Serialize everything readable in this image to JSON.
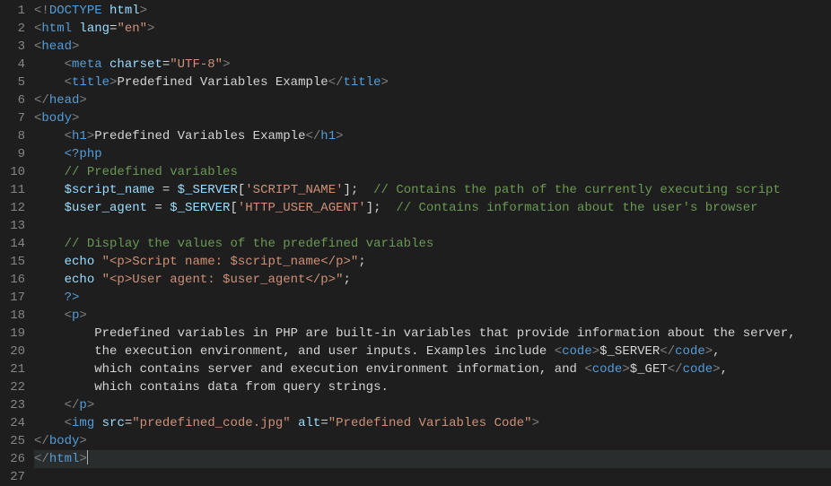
{
  "lineCount": 27,
  "activeLine": 26,
  "lines": [
    [
      [
        "tag-punct",
        "<!"
      ],
      [
        "doctype",
        "DOCTYPE"
      ],
      [
        "white",
        " "
      ],
      [
        "attr-name",
        "html"
      ],
      [
        "tag-punct",
        ">"
      ]
    ],
    [
      [
        "tag-punct",
        "<"
      ],
      [
        "tag-name",
        "html"
      ],
      [
        "white",
        " "
      ],
      [
        "attr-name",
        "lang"
      ],
      [
        "white",
        "="
      ],
      [
        "attr-val",
        "\"en\""
      ],
      [
        "tag-punct",
        ">"
      ]
    ],
    [
      [
        "tag-punct",
        "<"
      ],
      [
        "tag-name",
        "head"
      ],
      [
        "tag-punct",
        ">"
      ]
    ],
    [
      [
        "white",
        "    "
      ],
      [
        "tag-punct",
        "<"
      ],
      [
        "tag-name",
        "meta"
      ],
      [
        "white",
        " "
      ],
      [
        "attr-name",
        "charset"
      ],
      [
        "white",
        "="
      ],
      [
        "attr-val",
        "\"UTF-8\""
      ],
      [
        "tag-punct",
        ">"
      ]
    ],
    [
      [
        "white",
        "    "
      ],
      [
        "tag-punct",
        "<"
      ],
      [
        "tag-name",
        "title"
      ],
      [
        "tag-punct",
        ">"
      ],
      [
        "white",
        "Predefined Variables Example"
      ],
      [
        "tag-punct",
        "</"
      ],
      [
        "tag-name",
        "title"
      ],
      [
        "tag-punct",
        ">"
      ]
    ],
    [
      [
        "tag-punct",
        "</"
      ],
      [
        "tag-name",
        "head"
      ],
      [
        "tag-punct",
        ">"
      ]
    ],
    [
      [
        "tag-punct",
        "<"
      ],
      [
        "tag-name",
        "body"
      ],
      [
        "tag-punct",
        ">"
      ]
    ],
    [
      [
        "white",
        "    "
      ],
      [
        "tag-punct",
        "<"
      ],
      [
        "tag-name",
        "h1"
      ],
      [
        "tag-punct",
        ">"
      ],
      [
        "white",
        "Predefined Variables Example"
      ],
      [
        "tag-punct",
        "</"
      ],
      [
        "tag-name",
        "h1"
      ],
      [
        "tag-punct",
        ">"
      ]
    ],
    [
      [
        "white",
        "    "
      ],
      [
        "kw",
        "<?php"
      ]
    ],
    [
      [
        "white",
        "    "
      ],
      [
        "comment",
        "// Predefined variables"
      ]
    ],
    [
      [
        "white",
        "    "
      ],
      [
        "php-var",
        "$script_name"
      ],
      [
        "white",
        " = "
      ],
      [
        "php-var",
        "$_SERVER"
      ],
      [
        "white",
        "["
      ],
      [
        "str",
        "'SCRIPT_NAME'"
      ],
      [
        "white",
        "];  "
      ],
      [
        "comment",
        "// Contains the path of the currently executing script"
      ]
    ],
    [
      [
        "white",
        "    "
      ],
      [
        "php-var",
        "$user_agent"
      ],
      [
        "white",
        " = "
      ],
      [
        "php-var",
        "$_SERVER"
      ],
      [
        "white",
        "["
      ],
      [
        "str",
        "'HTTP_USER_AGENT'"
      ],
      [
        "white",
        "];  "
      ],
      [
        "comment",
        "// Contains information about the user's browser"
      ]
    ],
    [],
    [
      [
        "white",
        "    "
      ],
      [
        "comment",
        "// Display the values of the predefined variables"
      ]
    ],
    [
      [
        "white",
        "    "
      ],
      [
        "ident",
        "echo"
      ],
      [
        "white",
        " "
      ],
      [
        "str",
        "\"<p>Script name: $script_name</p>\""
      ],
      [
        "white",
        ";"
      ]
    ],
    [
      [
        "white",
        "    "
      ],
      [
        "ident",
        "echo"
      ],
      [
        "white",
        " "
      ],
      [
        "str",
        "\"<p>User agent: $user_agent</p>\""
      ],
      [
        "white",
        ";"
      ]
    ],
    [
      [
        "white",
        "    "
      ],
      [
        "kw",
        "?>"
      ]
    ],
    [
      [
        "white",
        "    "
      ],
      [
        "tag-punct",
        "<"
      ],
      [
        "tag-name",
        "p"
      ],
      [
        "tag-punct",
        ">"
      ]
    ],
    [
      [
        "white",
        "        "
      ],
      [
        "white",
        "Predefined variables in PHP are built-in variables that provide information about the server,"
      ]
    ],
    [
      [
        "white",
        "        "
      ],
      [
        "white",
        "the execution environment, and user inputs. Examples include "
      ],
      [
        "tag-punct",
        "<"
      ],
      [
        "tag-name",
        "code"
      ],
      [
        "tag-punct",
        ">"
      ],
      [
        "white",
        "$_SERVER"
      ],
      [
        "tag-punct",
        "</"
      ],
      [
        "tag-name",
        "code"
      ],
      [
        "tag-punct",
        ">"
      ],
      [
        "white",
        ","
      ]
    ],
    [
      [
        "white",
        "        "
      ],
      [
        "white",
        "which contains server and execution environment information, and "
      ],
      [
        "tag-punct",
        "<"
      ],
      [
        "tag-name",
        "code"
      ],
      [
        "tag-punct",
        ">"
      ],
      [
        "white",
        "$_GET"
      ],
      [
        "tag-punct",
        "</"
      ],
      [
        "tag-name",
        "code"
      ],
      [
        "tag-punct",
        ">"
      ],
      [
        "white",
        ","
      ]
    ],
    [
      [
        "white",
        "        "
      ],
      [
        "white",
        "which contains data from query strings."
      ]
    ],
    [
      [
        "white",
        "    "
      ],
      [
        "tag-punct",
        "</"
      ],
      [
        "tag-name",
        "p"
      ],
      [
        "tag-punct",
        ">"
      ]
    ],
    [
      [
        "white",
        "    "
      ],
      [
        "tag-punct",
        "<"
      ],
      [
        "tag-name",
        "img"
      ],
      [
        "white",
        " "
      ],
      [
        "attr-name",
        "src"
      ],
      [
        "white",
        "="
      ],
      [
        "attr-val",
        "\"predefined_code.jpg\""
      ],
      [
        "white",
        " "
      ],
      [
        "attr-name",
        "alt"
      ],
      [
        "white",
        "="
      ],
      [
        "attr-val",
        "\"Predefined Variables Code\""
      ],
      [
        "tag-punct",
        ">"
      ]
    ],
    [
      [
        "tag-punct",
        "</"
      ],
      [
        "tag-name",
        "body"
      ],
      [
        "tag-punct",
        ">"
      ]
    ],
    [
      [
        "tag-punct",
        "</"
      ],
      [
        "tag-name",
        "html"
      ],
      [
        "tag-punct",
        ">"
      ]
    ],
    []
  ]
}
